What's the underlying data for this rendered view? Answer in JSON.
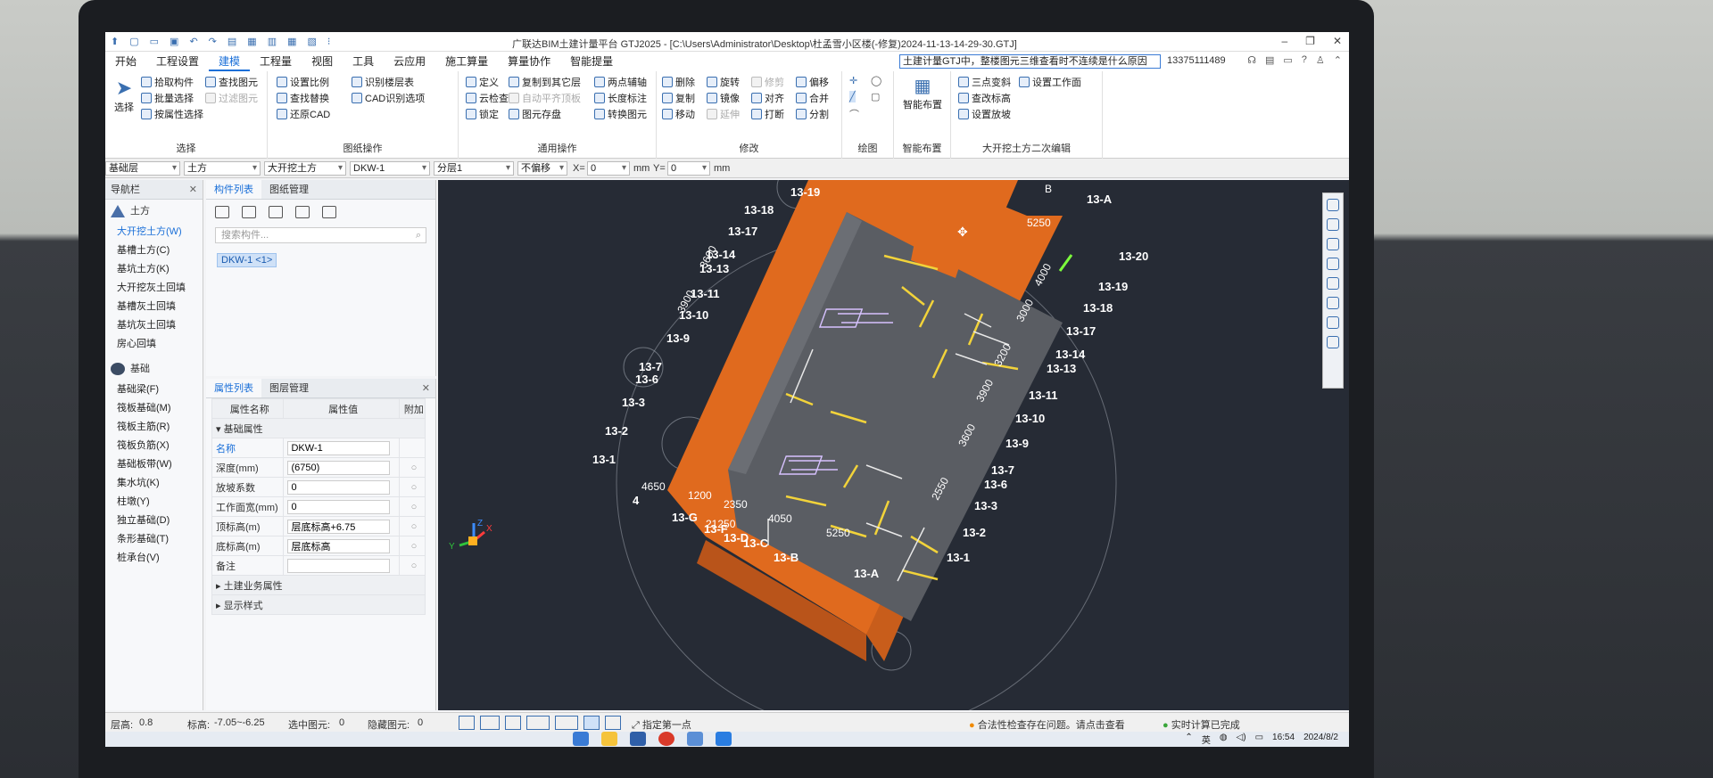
{
  "titlebar": {
    "title": "广联达BIM土建计量平台 GTJ2025 - [C:\\Users\\Administrator\\Desktop\\杜孟雪小区楼(-修复)2024-11-13-14-29-30.GTJ]"
  },
  "menu": [
    "开始",
    "工程设置",
    "建模",
    "工程量",
    "视图",
    "工具",
    "云应用",
    "施工算量",
    "算量协作",
    "智能提量"
  ],
  "menu_active": "建模",
  "search": {
    "value": "土建计量GTJ中，整楼图元三维查看时不连续是什么原因"
  },
  "account": "13375111489",
  "ribbon": {
    "select": {
      "big": "选择",
      "items": [
        "拾取构件",
        "批量选择",
        "按属性选择",
        "查找图元",
        "过滤图元"
      ],
      "label": "选择"
    },
    "drawing": {
      "items": [
        "设置比例",
        "识别楼层表",
        "查找替换",
        "CAD识别选项",
        "还原CAD"
      ],
      "label": "图纸操作"
    },
    "general": {
      "items": [
        "定义",
        "复制到其它层",
        "两点辅轴",
        "云检查",
        "自动平齐顶板",
        "长度标注",
        "锁定",
        "图元存盘",
        "转换图元"
      ],
      "label": "通用操作"
    },
    "modify": {
      "items": [
        "删除",
        "旋转",
        "修剪",
        "偏移",
        "复制",
        "镜像",
        "对齐",
        "合并",
        "移动",
        "延伸",
        "打断",
        "分割"
      ],
      "label": "修改"
    },
    "draw": {
      "label": "绘图"
    },
    "smart": {
      "big": "智能布置",
      "label": "智能布置"
    },
    "excav": {
      "items": [
        "三点变斜",
        "设置工作面",
        "查改标高",
        "设置放坡"
      ],
      "label": "大开挖土方二次编辑"
    }
  },
  "filters": {
    "layer": "基础层",
    "type": "土方",
    "subtype": "大开挖土方",
    "comp": "DKW-1",
    "axis": "分层1",
    "offset": "不偏移",
    "x_label": "X=",
    "x": "0",
    "x_unit": "mm",
    "y_label": "Y=",
    "y": "0",
    "y_unit": "mm"
  },
  "nav": {
    "title": "导航栏",
    "cat1": "土方",
    "items1": [
      "大开挖土方(W)",
      "基槽土方(C)",
      "基坑土方(K)",
      "大开挖灰土回填",
      "基槽灰土回填",
      "基坑灰土回填",
      "房心回填"
    ],
    "cat2": "基础",
    "items2": [
      "基础梁(F)",
      "筏板基础(M)",
      "筏板主筋(R)",
      "筏板负筋(X)",
      "基础板带(W)",
      "集水坑(K)",
      "柱墩(Y)",
      "独立基础(D)",
      "条形基础(T)",
      "桩承台(V)"
    ]
  },
  "comp": {
    "tab1": "构件列表",
    "tab2": "图纸管理",
    "search": "搜索构件...",
    "item": "DKW-1 <1>"
  },
  "props": {
    "tab1": "属性列表",
    "tab2": "图层管理",
    "headers": [
      "属性名称",
      "属性值",
      "附加"
    ],
    "section": "基础属性",
    "rows": [
      {
        "name": "名称",
        "value": "DKW-1"
      },
      {
        "name": "深度(mm)",
        "value": "(6750)"
      },
      {
        "name": "放坡系数",
        "value": "0"
      },
      {
        "name": "工作面宽(mm)",
        "value": "0"
      },
      {
        "name": "顶标高(m)",
        "value": "层底标高+6.75"
      },
      {
        "name": "底标高(m)",
        "value": "层底标高"
      },
      {
        "name": "备注",
        "value": ""
      }
    ],
    "sec2": "土建业务属性",
    "sec3": "显示样式"
  },
  "axes_left": [
    "13-19",
    "13-18",
    "13-17",
    "13-14",
    "13-13",
    "13-11",
    "13-10",
    "13-9",
    "13-7",
    "13-6",
    "13-3",
    "13-2",
    "13-1"
  ],
  "axes_right": [
    "13-A",
    "13-20",
    "13-19",
    "13-18",
    "13-17",
    "13-14",
    "13-13",
    "13-11",
    "13-10",
    "13-9",
    "13-7",
    "13-6",
    "13-3",
    "13-2",
    "13-1"
  ],
  "axes_bottom": [
    "13-G",
    "13-F",
    "13-D",
    "13-C",
    "13-B",
    "13-A",
    "4"
  ],
  "dims": [
    "5250",
    "4000",
    "3000",
    "3200",
    "3600",
    "3900",
    "4650",
    "1200",
    "2350",
    "4050",
    "21250",
    "2550",
    "B"
  ],
  "status": {
    "floor_h": "层高:",
    "floor_v": "0.8",
    "elev_l": "标高:",
    "elev_v": "-7.05~-6.25",
    "sel_l": "选中图元:",
    "sel_v": "0",
    "hid_l": "隐藏图元:",
    "hid_v": "0",
    "hint": "指定第一点",
    "warn": "合法性检查存在问题。请点击查看",
    "ok": "实时计算已完成"
  },
  "tray": {
    "lang": "英",
    "time": "16:54",
    "date": "2024/8/2"
  },
  "colors": {
    "accent": "#1a6fd8",
    "soil": "#e06a1e",
    "viewport": "#262b35"
  }
}
